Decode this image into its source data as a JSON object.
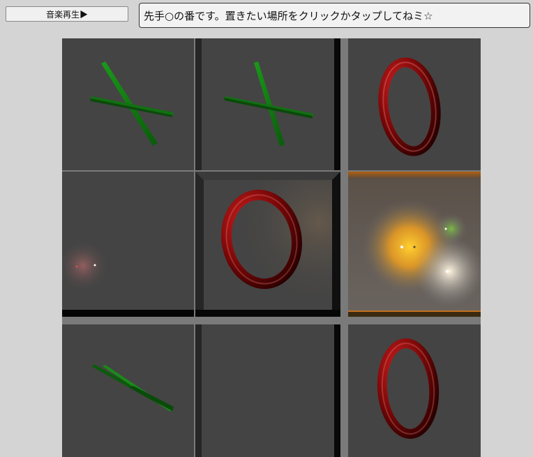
{
  "controls": {
    "music_button_label": "音楽再生▶"
  },
  "status_message": "先手○の番です。置きたい場所をクリックかタップしてねミ☆",
  "board": {
    "rows": 3,
    "cols": 3,
    "cells": [
      "X",
      "X",
      "O",
      "",
      "O",
      "",
      "X",
      "",
      "O"
    ]
  },
  "colors": {
    "x_mark": "#117a11",
    "o_mark": "#8a0a0a",
    "cell_bg": "#444444",
    "page_bg": "#d4d4d4"
  }
}
